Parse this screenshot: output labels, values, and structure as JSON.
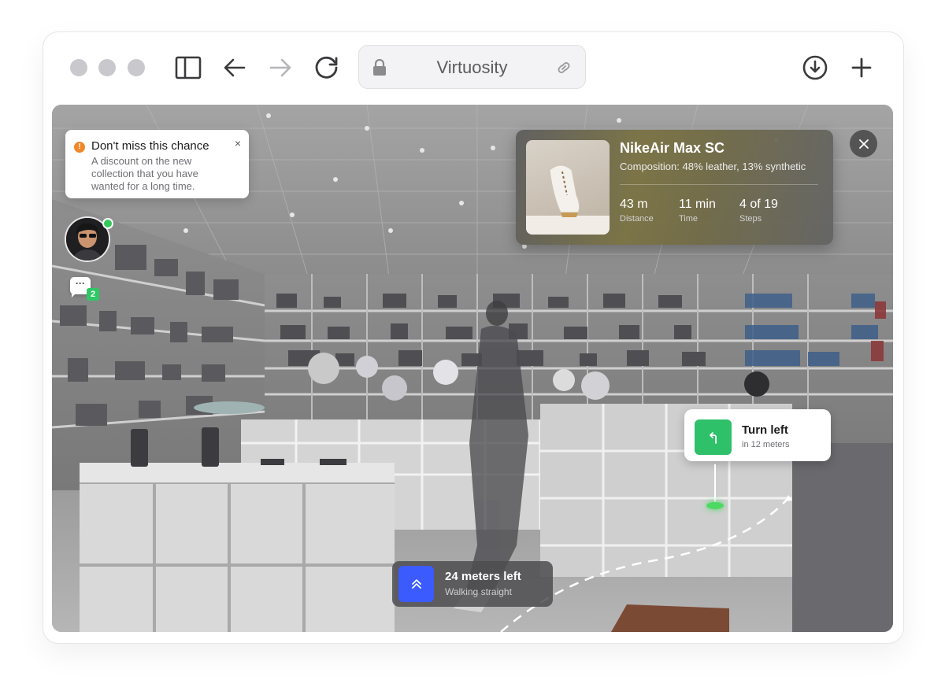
{
  "browser": {
    "address_title": "Virtuosity",
    "icons": [
      "sidebar-toggle-icon",
      "back-arrow-icon",
      "forward-arrow-icon",
      "reload-icon",
      "lock-icon",
      "link-icon",
      "download-icon",
      "plus-icon"
    ]
  },
  "notification": {
    "title": "Don't miss this chance",
    "body": "A discount on the new collection that you have wanted for a long time.",
    "close": "×"
  },
  "chat": {
    "bubble": "···",
    "unread_count": "2"
  },
  "product": {
    "name": "NikeAir Max SC",
    "composition": "Composition: 48% leather, 13% synthetic",
    "stats": [
      {
        "value": "43 m",
        "label": "Distance"
      },
      {
        "value": "11 min",
        "label": "Time"
      },
      {
        "value": "4 of 19",
        "label": "Steps"
      }
    ]
  },
  "direction": {
    "title": "Turn left",
    "subtitle": "in 12 meters"
  },
  "walking": {
    "title": "24 meters left",
    "subtitle": "Walking straight"
  },
  "colors": {
    "warn": "#f0882a",
    "turn_accent": "#2fc06a",
    "walk_accent": "#3b5bff",
    "online": "#34c759"
  }
}
